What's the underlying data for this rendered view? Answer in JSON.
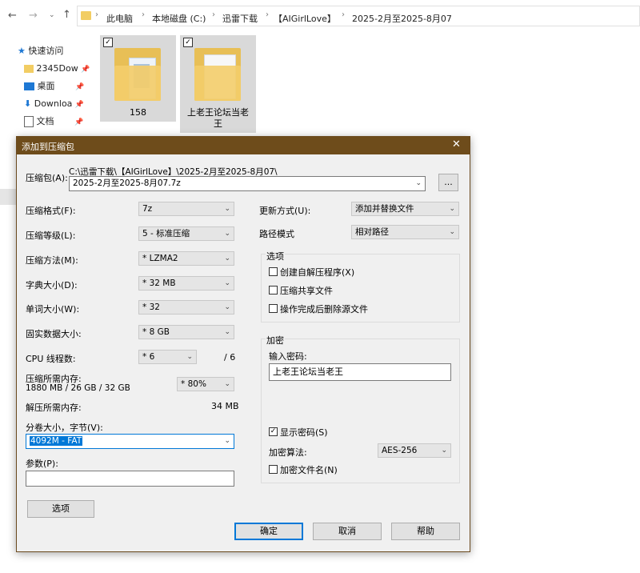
{
  "explorer": {
    "breadcrumbs": [
      "此电脑",
      "本地磁盘 (C:)",
      "迅雷下载",
      "【AIGirlLove】",
      "2025-2月至2025-8月07"
    ],
    "sidebar": [
      {
        "label": "快速访问"
      },
      {
        "label": "2345Dow"
      },
      {
        "label": "桌面"
      },
      {
        "label": "Downloa"
      },
      {
        "label": "文档"
      }
    ],
    "folders": [
      {
        "label": "158"
      },
      {
        "label": "上老王论坛当老王"
      }
    ]
  },
  "dialog": {
    "title": "添加到压缩包",
    "close": "✕",
    "archive_label": "压缩包(A):",
    "archive_path": "C:\\迅雷下载\\【AIGirlLove】\\2025-2月至2025-8月07\\",
    "archive_name": "2025-2月至2025-8月07.7z",
    "browse": "...",
    "left": {
      "format": {
        "label": "压缩格式(F):",
        "value": "7z"
      },
      "level": {
        "label": "压缩等级(L):",
        "value": "5 - 标准压缩"
      },
      "method": {
        "label": "压缩方法(M):",
        "value": "* LZMA2"
      },
      "dict": {
        "label": "字典大小(D):",
        "value": "* 32 MB"
      },
      "word": {
        "label": "单词大小(W):",
        "value": "* 32"
      },
      "solid": {
        "label": "固实数据大小:",
        "value": "* 8 GB"
      },
      "cpu": {
        "label": "CPU 线程数:",
        "value": "* 6",
        "total": "/ 6"
      },
      "mem_comp": {
        "label": "压缩所需内存:",
        "detail": "1880 MB / 26 GB / 32 GB",
        "value": "* 80%"
      },
      "mem_decomp": {
        "label": "解压所需内存:",
        "value": "34 MB"
      },
      "volume": {
        "label": "分卷大小，字节(V):",
        "value": "4092M - FAT"
      },
      "params": {
        "label": "参数(P):",
        "value": ""
      },
      "options_btn": "选项"
    },
    "right": {
      "update": {
        "label": "更新方式(U):",
        "value": "添加并替换文件"
      },
      "path": {
        "label": "路径模式",
        "value": "相对路径"
      },
      "options_group": "选项",
      "opt_sfx": "创建自解压程序(X)",
      "opt_shared": "压缩共享文件",
      "opt_delete": "操作完成后删除源文件",
      "encrypt_group": "加密",
      "password_label": "输入密码:",
      "password": "上老王论坛当老王",
      "show_password": "显示密码(S)",
      "algo_label": "加密算法:",
      "algo": "AES-256",
      "encrypt_names": "加密文件名(N)"
    },
    "ok": "确定",
    "cancel": "取消",
    "help": "帮助"
  }
}
